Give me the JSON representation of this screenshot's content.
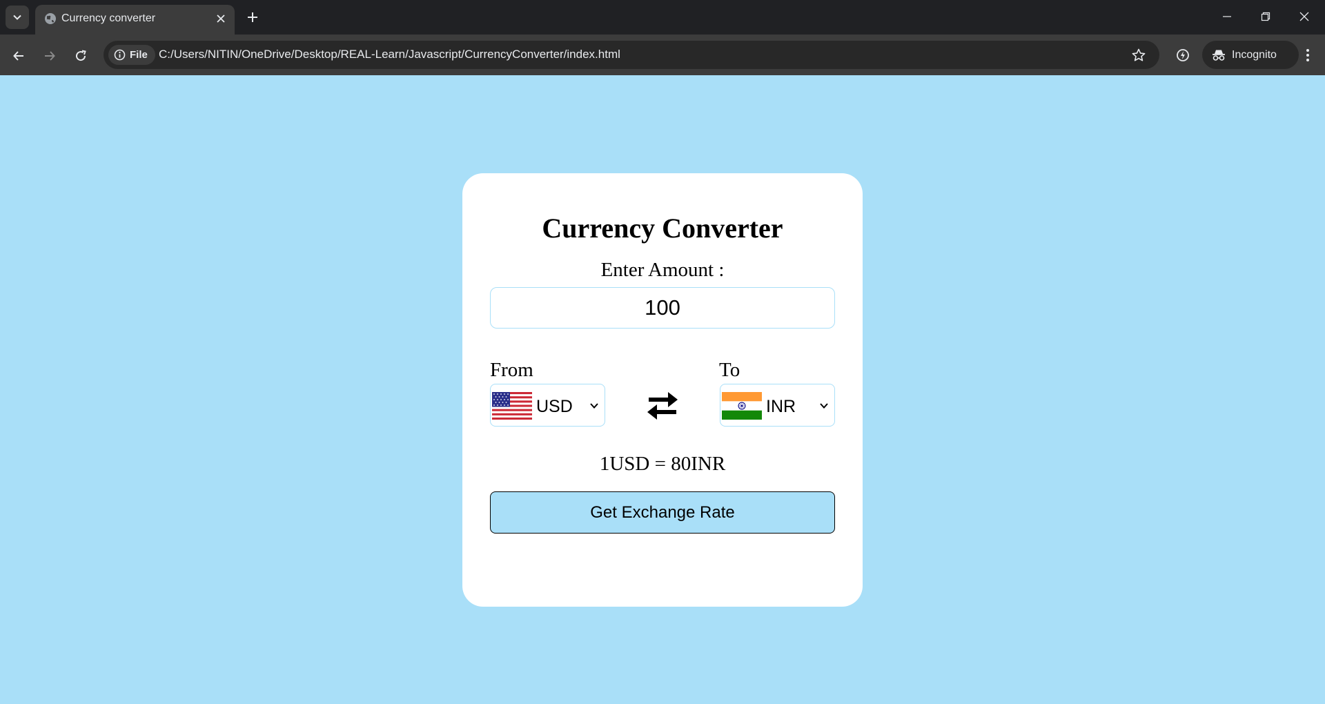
{
  "browser": {
    "tab_title": "Currency converter",
    "site_info_label": "File",
    "url": "C:/Users/NITIN/OneDrive/Desktop/REAL-Learn/Javascript/CurrencyConverter/index.html",
    "profile_label": "Incognito"
  },
  "app": {
    "heading": "Currency Converter",
    "amount_label": "Enter Amount :",
    "amount_value": "100",
    "from_label": "From",
    "from_currency": "USD",
    "to_label": "To",
    "to_currency": "INR",
    "rate_message": "1USD = 80INR",
    "button_label": "Get Exchange Rate"
  },
  "colors": {
    "page_background": "#a9dff8",
    "card_background": "#ffffff",
    "button_background": "#a9dff8"
  },
  "icons": {
    "swap": "swap-arrows-icon",
    "from_flag": "us-flag-icon",
    "to_flag": "india-flag-icon"
  }
}
